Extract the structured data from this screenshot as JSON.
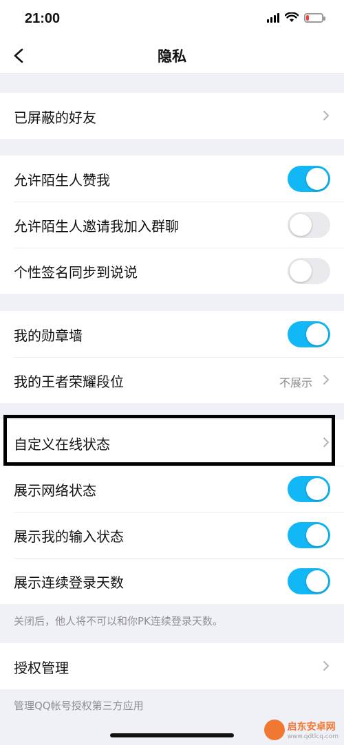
{
  "status_bar": {
    "time": "21:00"
  },
  "nav": {
    "title": "隐私"
  },
  "sections": {
    "blocked": {
      "label": "已屏蔽的好友"
    },
    "likes": {
      "label": "允许陌生人赞我",
      "on": true
    },
    "group_invite": {
      "label": "允许陌生人邀请我加入群聊",
      "on": false
    },
    "signature": {
      "label": "个性签名同步到说说",
      "on": false
    },
    "badge_wall": {
      "label": "我的勋章墙",
      "on": true
    },
    "honor_rank": {
      "label": "我的王者荣耀段位",
      "value": "不展示"
    },
    "custom_status": {
      "label": "自定义在线状态"
    },
    "network_status": {
      "label": "展示网络状态",
      "on": true
    },
    "typing_status": {
      "label": "展示我的输入状态",
      "on": true
    },
    "login_days": {
      "label": "展示连续登录天数",
      "on": true
    },
    "login_days_hint": "关闭后，他人将不可以和你PK连续登录天数。",
    "auth_manage": {
      "label": "授权管理"
    },
    "auth_manage_hint": "管理QQ帐号授权第三方应用"
  },
  "watermark": {
    "name": "启东安卓网",
    "url": "www.qdtlcq.com"
  },
  "colors": {
    "accent": "#12b7f5",
    "toggle_off": "#e9e9ee",
    "page_bg": "#f0f1f6"
  }
}
